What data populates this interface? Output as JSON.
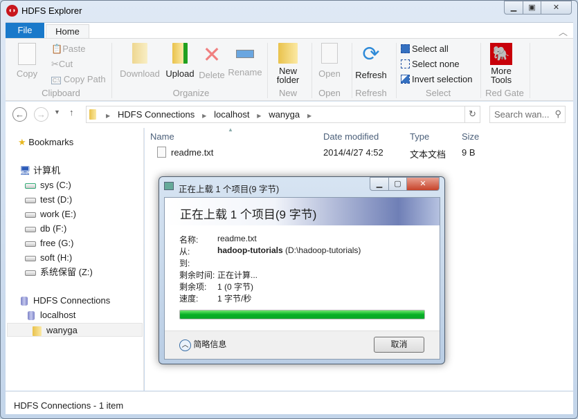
{
  "window": {
    "title": "HDFS Explorer",
    "controls": [
      "minimize",
      "maximize",
      "close"
    ]
  },
  "ribbon": {
    "tabs": {
      "file": "File",
      "home": "Home"
    },
    "clipboard": {
      "copy": "Copy",
      "paste": "Paste",
      "cut": "Cut",
      "copy_path": "Copy Path",
      "group": "Clipboard"
    },
    "organize": {
      "download": "Download",
      "upload": "Upload",
      "delete": "Delete",
      "rename": "Rename",
      "group": "Organize"
    },
    "new": {
      "new_folder_1": "New",
      "new_folder_2": "folder",
      "group": "New"
    },
    "open": {
      "open": "Open",
      "group": "Open"
    },
    "refresh": {
      "refresh": "Refresh",
      "group": "Refresh"
    },
    "select": {
      "select_all": "Select all",
      "select_none": "Select none",
      "invert": "Invert selection",
      "group": "Select"
    },
    "redgate": {
      "more_1": "More",
      "more_2": "Tools",
      "group": "Red Gate"
    }
  },
  "address": {
    "crumbs": [
      "HDFS Connections",
      "localhost",
      "wanyga"
    ],
    "search_placeholder": "Search wan..."
  },
  "sidebar": {
    "bookmarks": "Bookmarks",
    "computer": "计算机",
    "drives": [
      "sys (C:)",
      "test (D:)",
      "work (E:)",
      "db (F:)",
      "free (G:)",
      "soft (H:)",
      "系统保留 (Z:)"
    ],
    "hdfs": "HDFS Connections",
    "host": "localhost",
    "folder": "wanyga"
  },
  "files": {
    "columns": [
      "Name",
      "Date modified",
      "Type",
      "Size"
    ],
    "rows": [
      {
        "name": "readme.txt",
        "date": "2014/4/27 4:52",
        "type": "文本文档",
        "size": "9 B"
      }
    ]
  },
  "status": "HDFS Connections - 1 item",
  "dialog": {
    "title": "正在上载 1 个项目(9 字节)",
    "heading": "正在上载 1 个项目(9 字节)",
    "name_label": "名称:",
    "name_value": "readme.txt",
    "from_label": "从:",
    "from_bold": "hadoop-tutorials",
    "from_path": "(D:\\hadoop-tutorials)",
    "to_label": "到:",
    "time_label": "剩余时间:",
    "time_value": "正在计算...",
    "items_label": "剩余项:",
    "items_value": "1 (0 字节)",
    "speed_label": "速度:",
    "speed_value": "1 字节/秒",
    "progress_percent": 100,
    "progress_color": "#06b025",
    "details": "简略信息",
    "cancel": "取消"
  }
}
